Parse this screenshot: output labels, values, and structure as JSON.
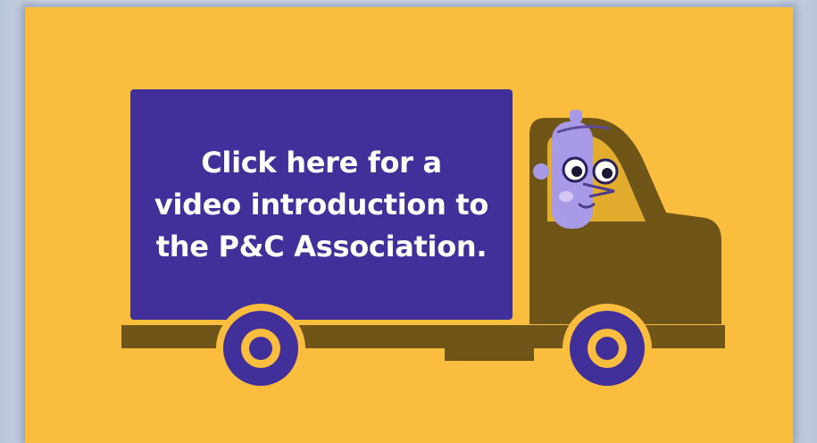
{
  "video_card": {
    "lines": [
      "Click here for a",
      "video introduction to",
      "the P&C Association."
    ]
  },
  "colors": {
    "background": "#fbbd3d",
    "truck_box": "#42309a",
    "cab": "#6f5618",
    "wheel": "#42309a",
    "driver": "#a99ae8"
  },
  "icons": {
    "truck": "truck-illustration",
    "driver": "driver-character"
  }
}
